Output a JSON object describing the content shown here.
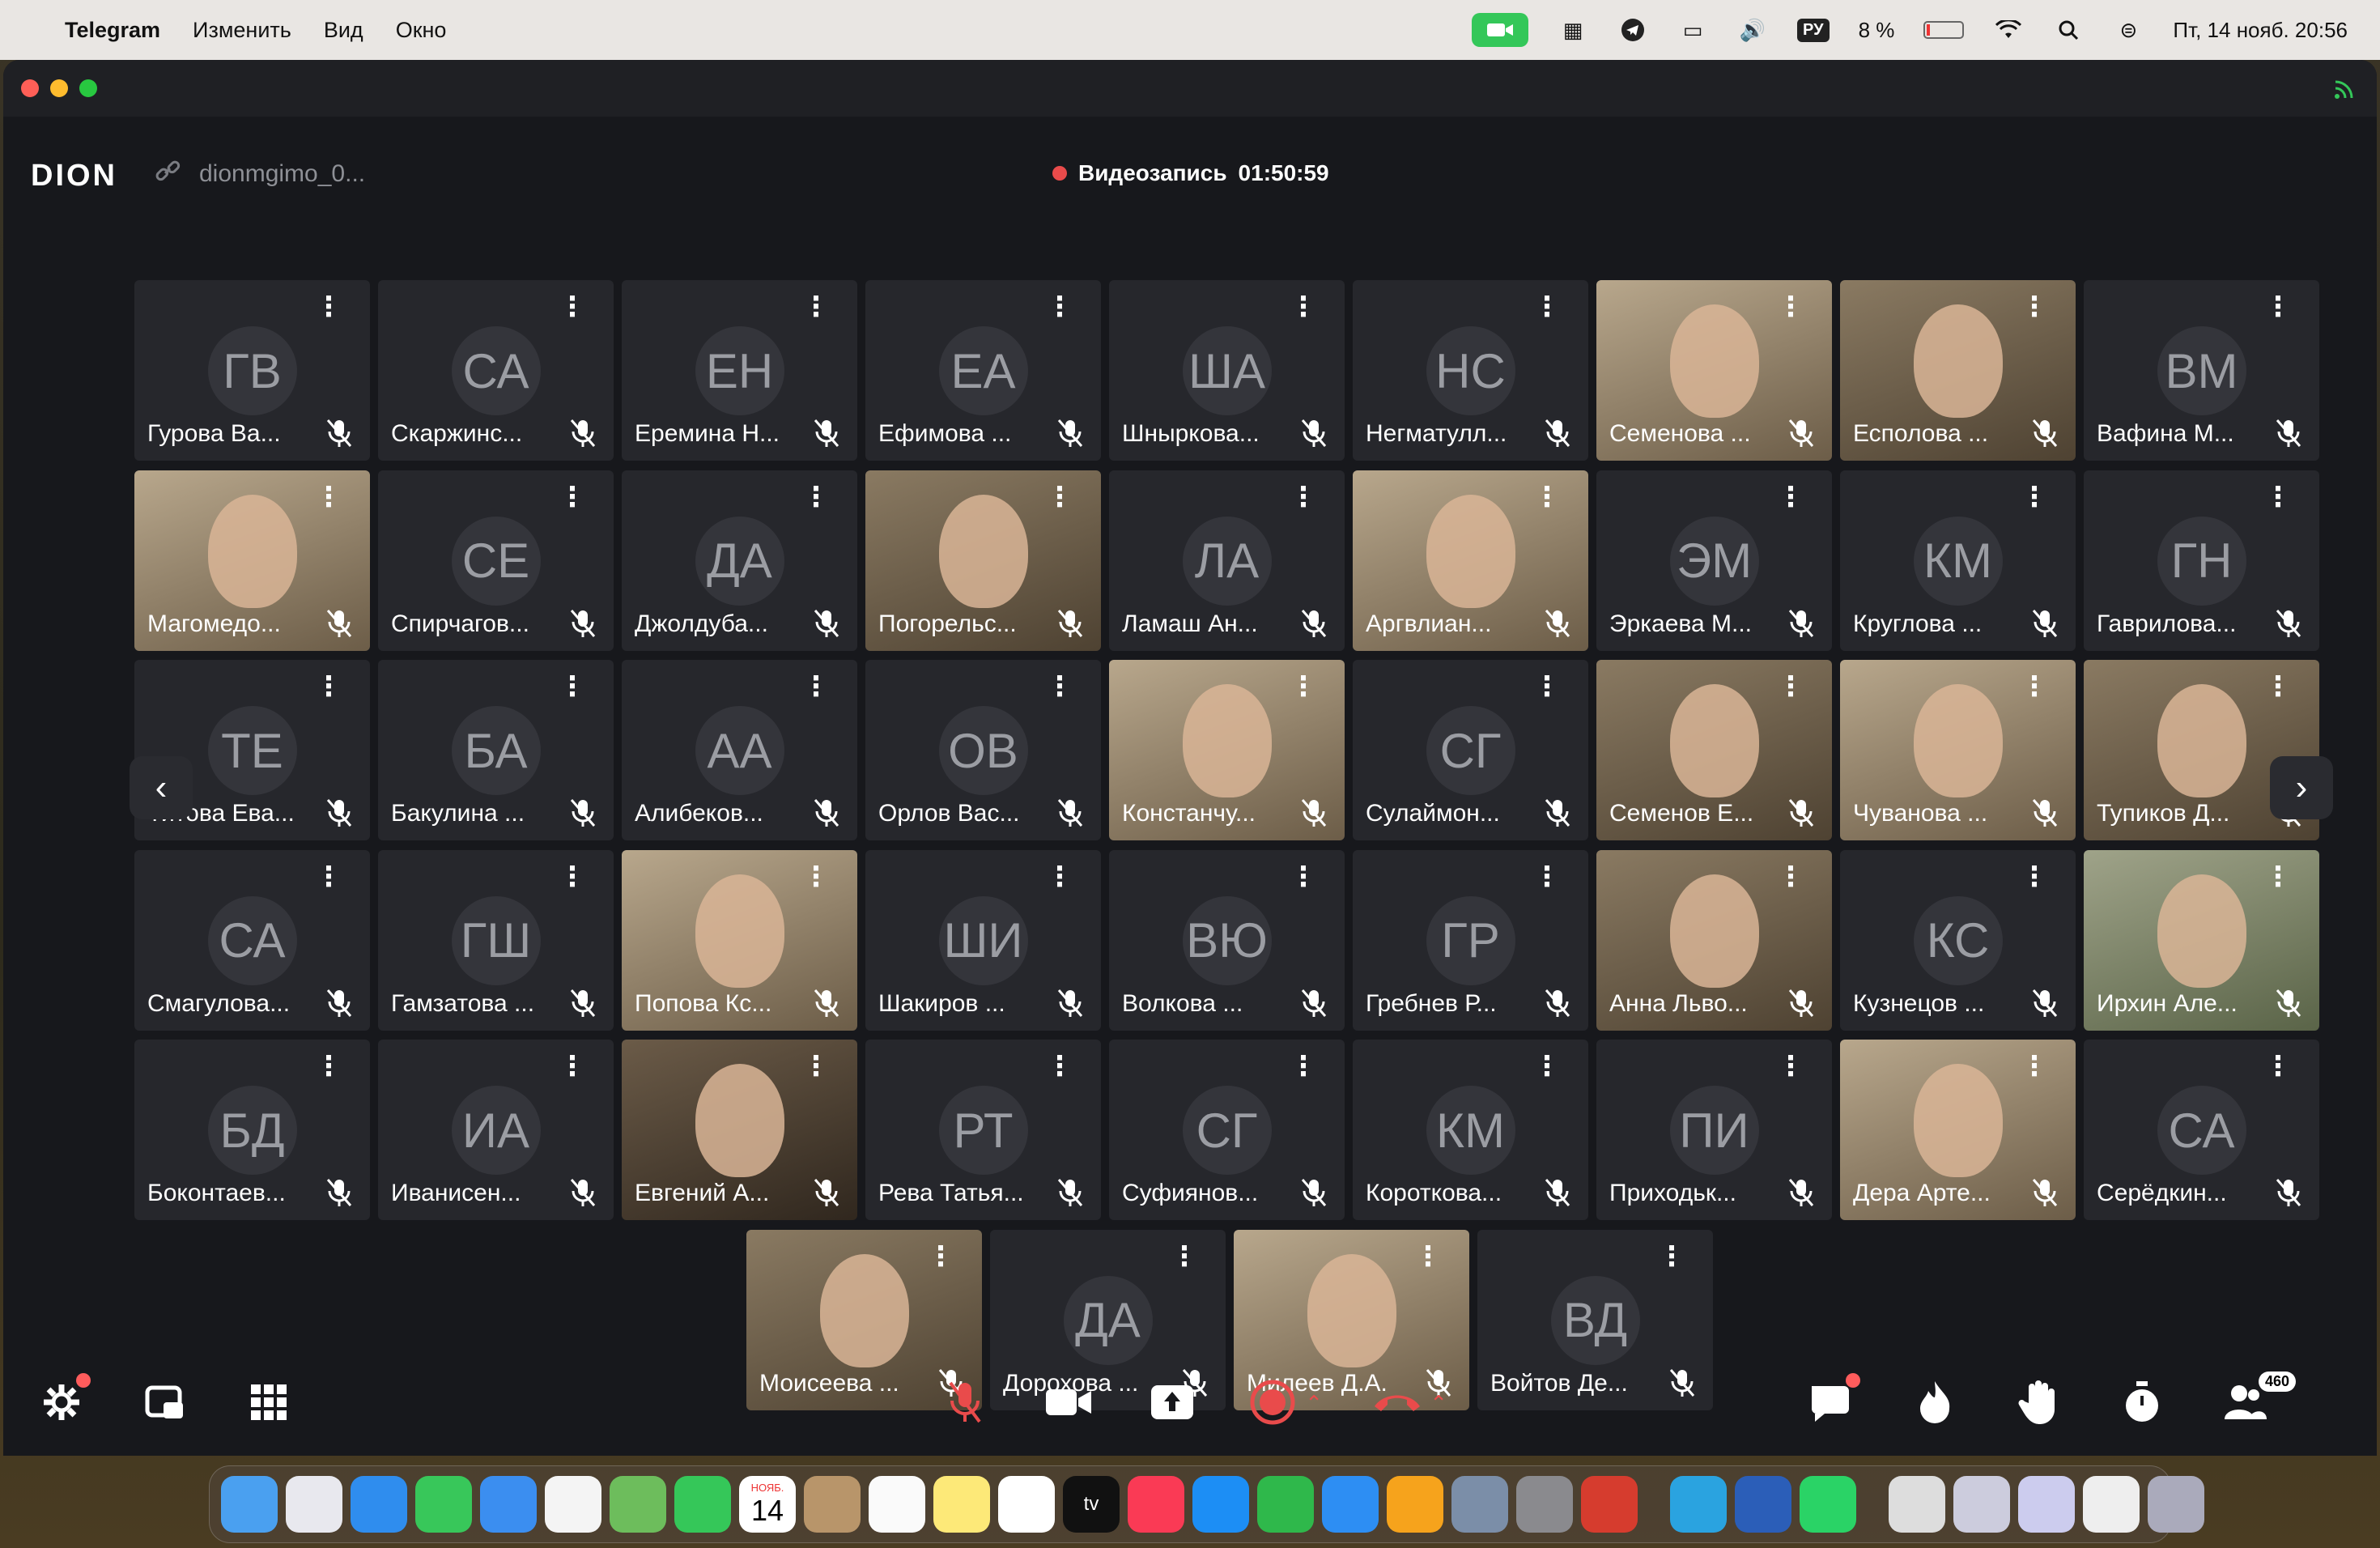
{
  "menubar": {
    "app": "Telegram",
    "items": [
      "Изменить",
      "Вид",
      "Окно"
    ],
    "lang": "РУ",
    "battery": "8 %",
    "datetime": "Пт, 14 нояб.  20:56"
  },
  "header": {
    "logo": "DION",
    "link": "dionmgimo_0...",
    "recording_label": "Видеозапись",
    "recording_time": "01:50:59"
  },
  "participants": [
    {
      "initials": "ГВ",
      "name": "Гурова Ва..."
    },
    {
      "initials": "СА",
      "name": "Скаржинс..."
    },
    {
      "initials": "ЕН",
      "name": "Еремина Н..."
    },
    {
      "initials": "ЕА",
      "name": "Ефимова ..."
    },
    {
      "initials": "ША",
      "name": "Шныркова..."
    },
    {
      "initials": "НС",
      "name": "Негматулл..."
    },
    {
      "initials": "",
      "name": "Семенова ...",
      "video": "v2"
    },
    {
      "initials": "",
      "name": "Есполова ...",
      "video": "video"
    },
    {
      "initials": "ВМ",
      "name": "Вафина М..."
    },
    {
      "initials": "",
      "name": "Магомедо...",
      "video": "v2"
    },
    {
      "initials": "СЕ",
      "name": "Спирчагов..."
    },
    {
      "initials": "ДА",
      "name": "Джолдуба..."
    },
    {
      "initials": "",
      "name": "Погорельс...",
      "video": "video"
    },
    {
      "initials": "ЛА",
      "name": "Ламаш Ан..."
    },
    {
      "initials": "",
      "name": "Аргвлиан...",
      "video": "v2"
    },
    {
      "initials": "ЭМ",
      "name": "Эркаева М..."
    },
    {
      "initials": "КМ",
      "name": "Круглова ..."
    },
    {
      "initials": "ГН",
      "name": "Гаврилова..."
    },
    {
      "initials": "ТЕ",
      "name": "Титова Ева..."
    },
    {
      "initials": "БА",
      "name": "Бакулина ..."
    },
    {
      "initials": "АА",
      "name": "Алибеков..."
    },
    {
      "initials": "ОВ",
      "name": "Орлов Вас..."
    },
    {
      "initials": "",
      "name": "Констанчу...",
      "video": "v2"
    },
    {
      "initials": "СГ",
      "name": "Сулаймон..."
    },
    {
      "initials": "",
      "name": "Семенов Е...",
      "video": "video"
    },
    {
      "initials": "",
      "name": "Чуванова ...",
      "video": "v2"
    },
    {
      "initials": "",
      "name": "Тупиков Д...",
      "video": "video"
    },
    {
      "initials": "СА",
      "name": "Смагулова..."
    },
    {
      "initials": "ГШ",
      "name": "Гамзатова ..."
    },
    {
      "initials": "",
      "name": "Попова Кс...",
      "video": "v2"
    },
    {
      "initials": "ШИ",
      "name": "Шакиров ..."
    },
    {
      "initials": "ВЮ",
      "name": "Волкова ..."
    },
    {
      "initials": "ГР",
      "name": "Гребнев Р..."
    },
    {
      "initials": "",
      "name": "Анна Льво...",
      "video": "video"
    },
    {
      "initials": "КС",
      "name": "Кузнецов ..."
    },
    {
      "initials": "",
      "name": "Ирхин Але...",
      "video": "v4"
    },
    {
      "initials": "БД",
      "name": "Боконтаев..."
    },
    {
      "initials": "ИА",
      "name": "Иванисен..."
    },
    {
      "initials": "",
      "name": "Евгений А...",
      "video": "v3"
    },
    {
      "initials": "РТ",
      "name": "Рева Татья..."
    },
    {
      "initials": "СГ",
      "name": "Суфиянов..."
    },
    {
      "initials": "КМ",
      "name": "Короткова..."
    },
    {
      "initials": "ПИ",
      "name": "Приходьк..."
    },
    {
      "initials": "",
      "name": "Дера Арте...",
      "video": "v2"
    },
    {
      "initials": "СА",
      "name": "Серёдкин..."
    },
    {
      "initials": "",
      "name": "Моисеева ...",
      "video": "video"
    },
    {
      "initials": "ДА",
      "name": "Дорохова ..."
    },
    {
      "initials": "",
      "name": "Милеев Д.А.",
      "video": "v2"
    },
    {
      "initials": "ВД",
      "name": "Войтов Де..."
    }
  ],
  "toolbar": {
    "participants_count": "460"
  },
  "colors": {
    "window_bg": "#17181c",
    "tile_bg": "#26272c",
    "recording_dot": "#e94b4b",
    "mic_off": "#e94b4b",
    "hangup": "#e94b4b"
  },
  "dock": {
    "calendar_month": "НОЯБ.",
    "calendar_day": "14",
    "tv_label": "tv"
  }
}
